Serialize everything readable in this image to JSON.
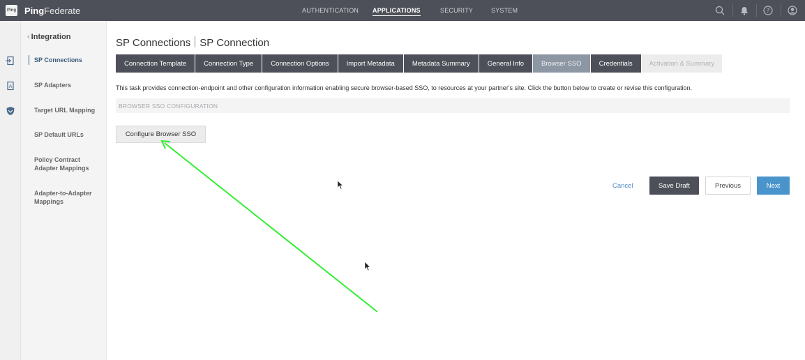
{
  "header": {
    "logo_text": "Ping",
    "app_name_bold": "Ping",
    "app_name_rest": "Federate",
    "nav": [
      {
        "label": "AUTHENTICATION",
        "active": false
      },
      {
        "label": "APPLICATIONS",
        "active": true
      },
      {
        "label": "SECURITY",
        "active": false
      },
      {
        "label": "SYSTEM",
        "active": false
      }
    ],
    "icons": [
      "search-icon",
      "bell-icon",
      "help-icon",
      "user-icon"
    ]
  },
  "rail": {
    "icons": [
      "connection-icon",
      "adapter-icon",
      "shield-icon"
    ]
  },
  "sidebar": {
    "back_label": "Integration",
    "items": [
      {
        "label": "SP Connections",
        "active": true
      },
      {
        "label": "SP Adapters",
        "active": false
      },
      {
        "label": "Target URL Mapping",
        "active": false
      },
      {
        "label": "SP Default URLs",
        "active": false
      },
      {
        "label": "Policy Contract Adapter Mappings",
        "active": false
      },
      {
        "label": "Adapter-to-Adapter Mappings",
        "active": false
      }
    ]
  },
  "main": {
    "breadcrumb": [
      "SP Connections",
      "SP Connection"
    ],
    "tabs": [
      {
        "label": "Connection Template",
        "state": "done"
      },
      {
        "label": "Connection Type",
        "state": "done"
      },
      {
        "label": "Connection Options",
        "state": "done"
      },
      {
        "label": "Import Metadata",
        "state": "done"
      },
      {
        "label": "Metadata Summary",
        "state": "done"
      },
      {
        "label": "General Info",
        "state": "done"
      },
      {
        "label": "Browser SSO",
        "state": "current"
      },
      {
        "label": "Credentials",
        "state": "done"
      },
      {
        "label": "Activation & Summary",
        "state": "disabled"
      }
    ],
    "description": "This task provides connection-endpoint and other configuration information enabling secure browser-based SSO, to resources at your partner's site. Click the button below to create or revise this configuration.",
    "section_title": "BROWSER SSO CONFIGURATION",
    "configure_button": "Configure Browser SSO",
    "actions": {
      "cancel": "Cancel",
      "save_draft": "Save Draft",
      "previous": "Previous",
      "next": "Next"
    }
  },
  "colors": {
    "topbar": "#4d5058",
    "tab_current": "#8d96a3",
    "next_button": "#4a94cc",
    "annotation_arrow": "#33ee33"
  }
}
